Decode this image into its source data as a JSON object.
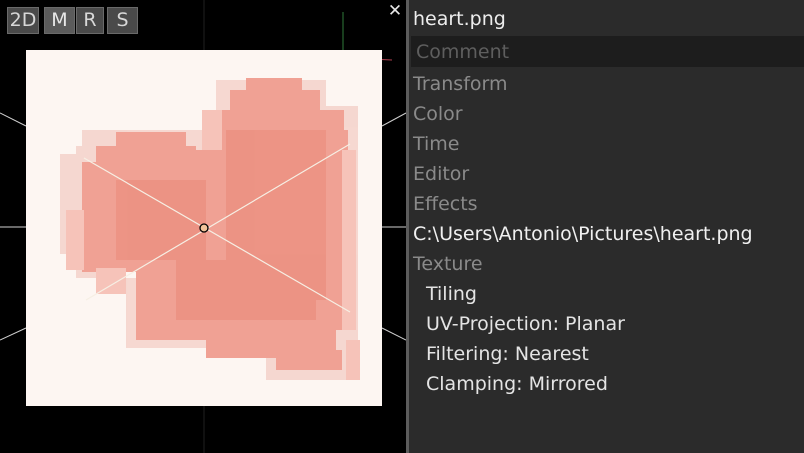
{
  "viewport": {
    "modes": [
      {
        "label": "2D",
        "active": false
      },
      {
        "label": "M",
        "active": true
      },
      {
        "label": "R",
        "active": false
      },
      {
        "label": "S",
        "active": false
      }
    ],
    "close_glyph": "✕"
  },
  "panel": {
    "title": "heart.png",
    "comment_placeholder": "Comment",
    "comment_value": "",
    "sections": {
      "transform": "Transform",
      "color": "Color",
      "time": "Time",
      "editor": "Editor",
      "effects": "Effects",
      "texture": "Texture"
    },
    "path": "C:\\Users\\Antonio\\Pictures\\heart.png",
    "texture_items": {
      "tiling": "Tiling",
      "uv_projection": "UV-Projection: Planar",
      "filtering": "Filtering: Nearest",
      "clamping": "Clamping: Mirrored"
    }
  },
  "colors": {
    "panel_bg": "#2b2b2b",
    "section_text": "#8a8a8a",
    "heart": "#f19d90",
    "image_bg": "#fdf5f1"
  },
  "icons": [
    "close-icon",
    "pivot-icon"
  ]
}
